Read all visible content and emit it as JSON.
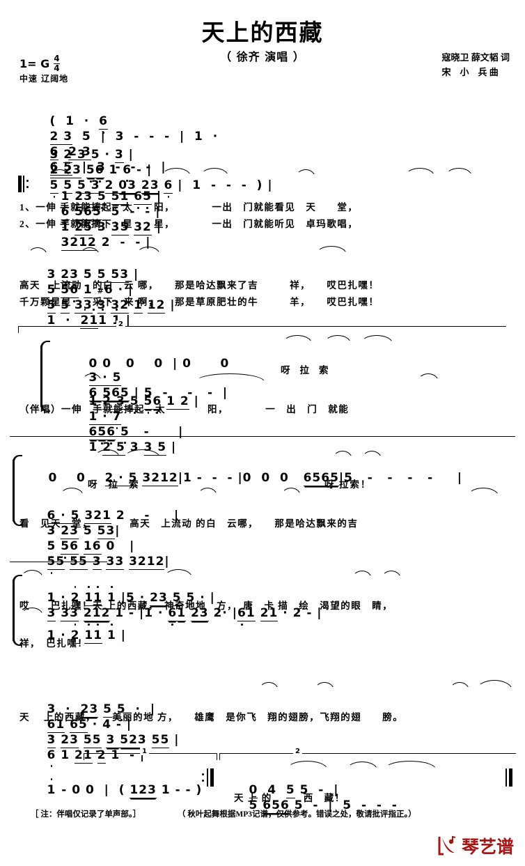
{
  "header": {
    "title": "天上的西藏",
    "performer": "（ 徐齐 演唱 ）",
    "key": "1= G",
    "meter_num": "4",
    "meter_den": "4",
    "tempo": "中速 辽阔地",
    "lyricist": "寇晓卫 薛文韬 词",
    "composer": "宋　小　兵 曲"
  },
  "intro": {
    "line1": "(  1  ·  6  2 3  5  |  3  -  -  -  |  1  ·  6  2 3  6 5  |  3  -  -  -  |",
    "line2": "3 2 3  5 · 3  |  2 23 56 1 6 -  |  5 5 5 3 2 03 23 6  |  1  -  -  -  ) |"
  },
  "verse1": {
    "notes_a": "‖: 1 23 5 51 65 | 6 565  5 - - | 1 25 3 35 32 | 3 212 2 - - |",
    "lyrics_1a": "1、一伸 手就能捧起　太　　阳，　　　　一出　门就能看见　天　　堂，",
    "lyrics_2a": "2、一伸 手就能摘下　星　　星，　　　　一出　门就能听见　卓玛歌唱，",
    "notes_b": "3 23 5 5 53 | 5 56 1 #6 · | 5 5 33 3 32 1 12 | 1 · 2 11 1 |",
    "lyrics_1b": "高天　上流动　的白　云 哪，　　那是哈达飘来了吉　　　祥，　　哎巴扎嘿！",
    "lyrics_2b": "千万颗星星　　采下　来 啊，　　那是草原肥壮的牛　　　羊，　　哎巴扎嘿！"
  },
  "chorus_a": {
    "upper_notes": "0 0   0   0  | 0     0    3 · 5  6 565 | 5  -   -  -  |",
    "upper_lyrics": "　　　　　　　　　　　　　　　　　呀　　拉　　索",
    "lower_notes": "1 23 5 56 1 2 | 1 · 7 65 6 5    -      | 1 25 3 35 |",
    "lower_lyrics": "（伴唱）一伸　手就能捧起　太　　　　阳，　　　　一　出　门　就能",
    "volta_label": "2"
  },
  "chorus_b": {
    "upper_notes": "0   0   2 · 5 3212 | 1 - - - | 0 0 0  6565 | 5  -  -  -  -  |",
    "upper_lyrics": "　　　呀　　拉　　索　　　　　　　　呀 拉索！",
    "lower_notes": "6 · 5 321 2    -    | 3 23 5 53 | 5 56 16 0  | 55 55 3 33 3212 |",
    "lower_lyrics": "看　见天　堂，　　　　高天　上流动 的白　云哪，　　那是哈达飘来的吉"
  },
  "chorus_c": {
    "upper_notes": "1 · 2 11 1 | 5 · 23 5 5 · | 3 33 212 1 - | 1 · 61 23 2· | 61 21 · 2 - |",
    "upper_lyrics": "哎　　巴扎嘿！天 上的西藏，　神奇地地　方，　唐　卡 描　绘　渴望的眼　睛，",
    "lower_notes": "1 · 2 11 1 |",
    "lower_lyrics": "祥，　巴扎嘿！"
  },
  "last_line": {
    "notes": "3 · 23 5 5 · | 61 65 · 4 - | 3 23 55 3 523 55 | 6 1 21 2 1 - |",
    "lyrics": "天　 上的西藏，　　美丽的地 方，　　雄鹰　是你飞　翔的翅膀，飞翔的翅　　膀。"
  },
  "ending": {
    "volta1_label": "1",
    "volta2_label": "2",
    "notes1": "1 - 0 0 |  ( 123 1 - - )  :‖",
    "notes2": "0 4 5 5 - | 5 65 6 5 - | 5 - - - ‖",
    "lyrics2": "天 上 的　　　西　藏！"
  },
  "footer": {
    "note_left": "［ 注：伴唱仅记录了单声部。］",
    "note_right": "（ 秋叶起舞根据MP3记谱，仅供参考。错误之处，敬请批评指正。）",
    "logo_text": "琴艺谱",
    "logo_color": "#a81414"
  }
}
